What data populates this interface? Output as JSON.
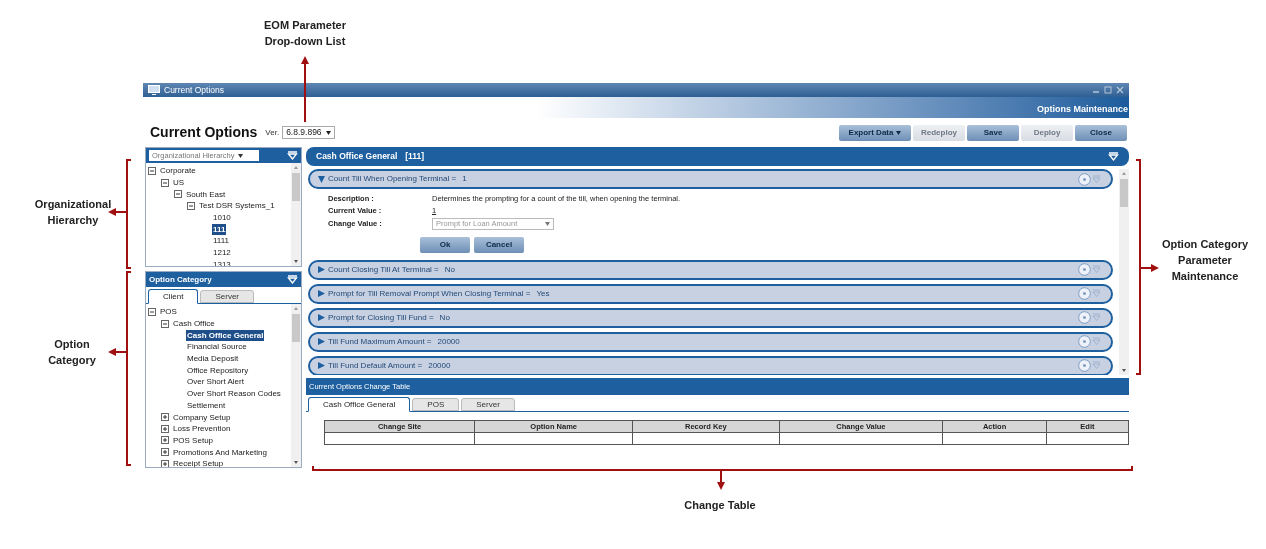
{
  "annotations": [
    {
      "text": "EOM Parameter Drop-down List"
    },
    {
      "text": "Organizational Hierarchy"
    },
    {
      "text": "Option Category"
    },
    {
      "text": "Option Category Parameter Maintenance"
    },
    {
      "text": "Change Table"
    }
  ],
  "window": {
    "title": "Current Options",
    "banner": "Options Maintenance"
  },
  "toolbar": {
    "heading": "Current Options",
    "version_label": "Ver.",
    "version": "6.8.9.896",
    "buttons": [
      {
        "label": "Export Data",
        "dropdown": true,
        "disabled": false
      },
      {
        "label": "Redeploy",
        "dropdown": false,
        "disabled": true
      },
      {
        "label": "Save",
        "dropdown": false,
        "disabled": false
      },
      {
        "label": "Deploy",
        "dropdown": false,
        "disabled": true
      },
      {
        "label": "Close",
        "dropdown": false,
        "disabled": false
      }
    ]
  },
  "org_panel": {
    "selector": "Organizational Hierarchy",
    "tree": [
      {
        "label": "Corporate",
        "expanded": true,
        "selected": false,
        "children": [
          {
            "label": "US",
            "expanded": true,
            "selected": false,
            "children": [
              {
                "label": "South East",
                "expanded": true,
                "selected": false,
                "children": [
                  {
                    "label": "Test DSR Systems_1",
                    "expanded": true,
                    "selected": false,
                    "children": [
                      {
                        "label": "1010",
                        "selected": false
                      },
                      {
                        "label": "111",
                        "selected": true
                      },
                      {
                        "label": "1111",
                        "selected": false
                      },
                      {
                        "label": "1212",
                        "selected": false
                      },
                      {
                        "label": "1313",
                        "selected": false
                      }
                    ]
                  }
                ]
              }
            ]
          }
        ]
      }
    ]
  },
  "category_panel": {
    "title": "Option Category",
    "tabs": [
      {
        "label": "Client",
        "selected": true
      },
      {
        "label": "Server",
        "selected": false
      }
    ],
    "tree": [
      {
        "label": "POS",
        "expanded": true,
        "selected": false,
        "children": [
          {
            "label": "Cash Office",
            "expanded": true,
            "selected": false,
            "children": [
              {
                "label": "Cash Office General",
                "selected": true
              },
              {
                "label": "Financial Source",
                "selected": false
              },
              {
                "label": "Media Deposit",
                "selected": false
              },
              {
                "label": "Office Repository",
                "selected": false
              },
              {
                "label": "Over Short Alert",
                "selected": false
              },
              {
                "label": "Over Short Reason Codes",
                "selected": false
              },
              {
                "label": "Settlement",
                "selected": false
              }
            ]
          },
          {
            "label": "Company Setup",
            "expanded": false,
            "selected": false
          },
          {
            "label": "Loss Prevention",
            "expanded": false,
            "selected": false
          },
          {
            "label": "POS Setup",
            "expanded": false,
            "selected": false
          },
          {
            "label": "Promotions And Marketing",
            "expanded": false,
            "selected": false
          },
          {
            "label": "Receipt Setup",
            "expanded": false,
            "selected": false
          }
        ]
      }
    ]
  },
  "options_panel": {
    "title": "Cash Office General",
    "site": "[111]",
    "options": [
      {
        "label": "Count Till When Opening Terminal =",
        "value": "1",
        "expanded": true,
        "details": {
          "description_label": "Description :",
          "description": "Determines the prompting for a count of the till, when opening the terminal.",
          "current_label": "Current Value :",
          "current": "1",
          "change_label": "Change Value :",
          "change_value": "Prompt for Loan Amount",
          "ok": "Ok",
          "cancel": "Cancel"
        }
      },
      {
        "label": "Count Closing Till At Terminal =",
        "value": "No",
        "expanded": false
      },
      {
        "label": "Prompt for Till Removal Prompt When Closing Terminal =",
        "value": "Yes",
        "expanded": false
      },
      {
        "label": "Prompt for Closing Till Fund =",
        "value": "No",
        "expanded": false
      },
      {
        "label": "Till Fund Maximum Amount =",
        "value": "20000",
        "expanded": false
      },
      {
        "label": "Till Fund Default Amount =",
        "value": "20000",
        "expanded": false
      }
    ]
  },
  "change_table": {
    "title": "Current Options Change Table",
    "tabs": [
      {
        "label": "Cash Office General",
        "selected": true
      },
      {
        "label": "POS",
        "selected": false
      },
      {
        "label": "Server",
        "selected": false
      }
    ],
    "columns": [
      "Change Site",
      "Option Name",
      "Record Key",
      "Change Value",
      "Action",
      "Edit"
    ]
  }
}
